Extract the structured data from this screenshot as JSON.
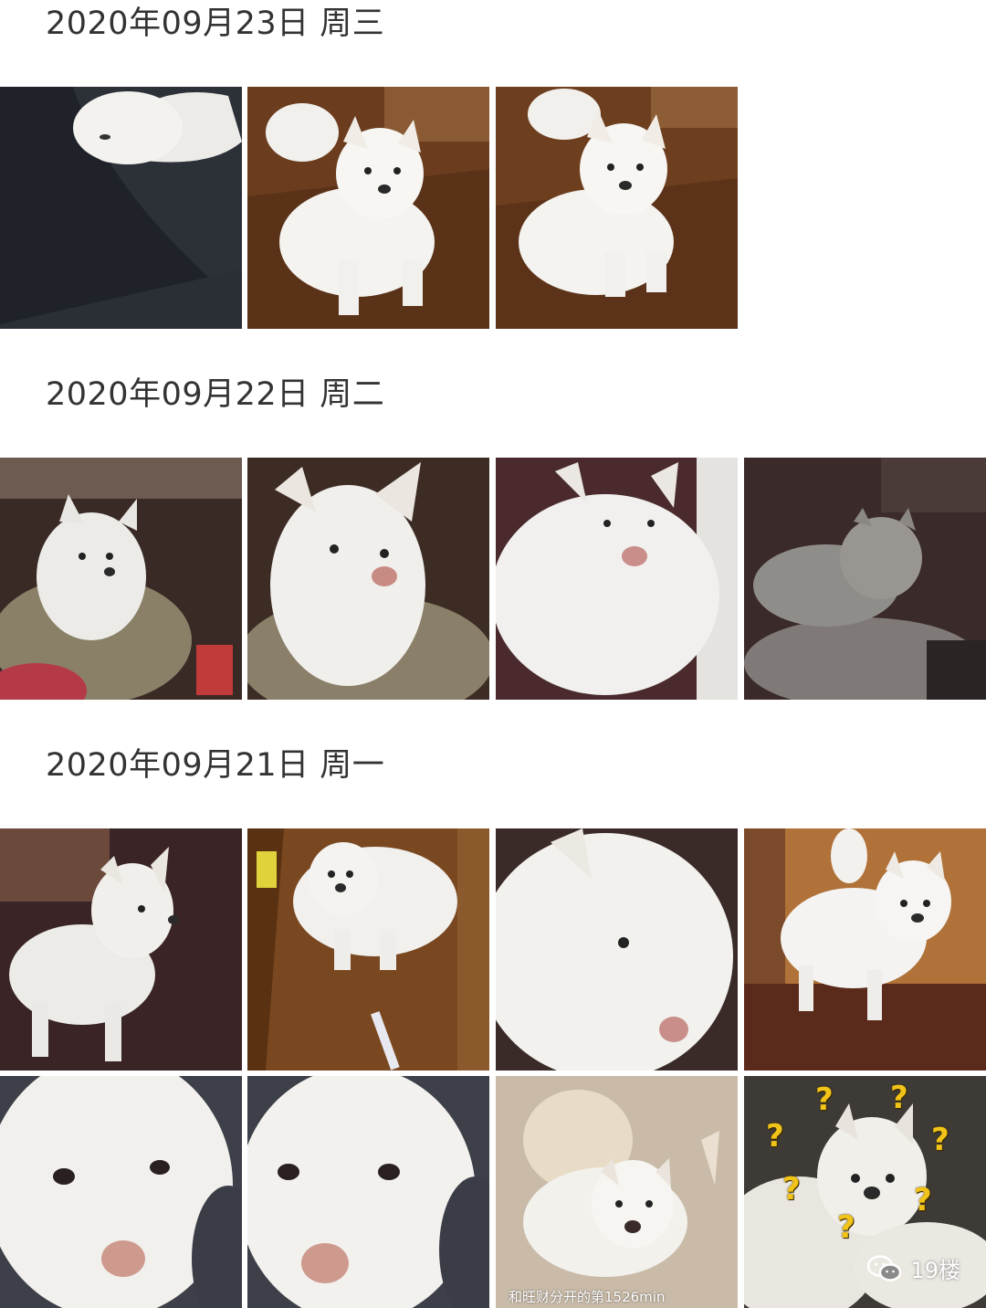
{
  "sections": [
    {
      "date": "2020年09月23日",
      "weekday": "周三"
    },
    {
      "date": "2020年09月22日",
      "weekday": "周二"
    },
    {
      "date": "2020年09月21日",
      "weekday": "周一"
    }
  ],
  "photos": {
    "caption_last": "和旺财分开的第1526min",
    "question_mark": "?"
  },
  "watermark": {
    "icon": "wechat-icon",
    "text": "19楼"
  },
  "colors": {
    "background": "#ffffff",
    "header_text": "#333333",
    "question_mark": "#f2c318"
  }
}
